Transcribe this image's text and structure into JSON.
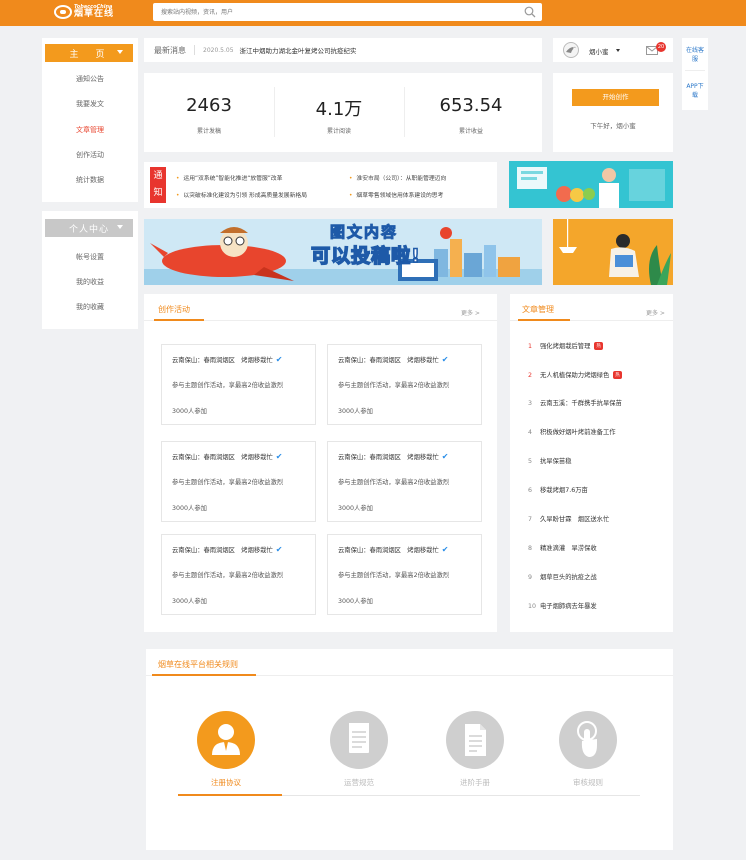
{
  "header": {
    "logo_en": "TobaccoChina",
    "logo_cn": "烟草在线",
    "search_placeholder": "搜索站内视频，资讯，用户"
  },
  "sidebar_main": {
    "title": "主　页",
    "items": [
      {
        "label": "通知公告",
        "active": false
      },
      {
        "label": "我要发文",
        "active": false
      },
      {
        "label": "文章管理",
        "active": true
      },
      {
        "label": "创作活动",
        "active": false
      },
      {
        "label": "统计数据",
        "active": false
      }
    ]
  },
  "sidebar_personal": {
    "title": "个人中心",
    "items": [
      {
        "label": "帐号设置"
      },
      {
        "label": "我的收益"
      },
      {
        "label": "我的收藏"
      }
    ]
  },
  "news": {
    "label": "最新消息",
    "date": "2020.5.05",
    "title": "浙江中烟助力湖北金叶复烤公司抗疫纪实"
  },
  "user": {
    "name": "烟小蜜",
    "unread": "20"
  },
  "side_tabs": [
    {
      "label": "在线客服"
    },
    {
      "label": "APP下载"
    }
  ],
  "stats": [
    {
      "value": "2463",
      "label": "累计发稿"
    },
    {
      "value": "4.1万",
      "label": "累计阅读"
    },
    {
      "value": "653.54",
      "label": "累计收益"
    }
  ],
  "start": {
    "button": "开始创作",
    "greeting": "下午好，烟小蜜"
  },
  "notice": {
    "tag": "通知",
    "items": [
      "运用“双系统”智能化推进“放管服”改革",
      "淮安市局（公司）：从职能管理迈向",
      "以突破标准化建设为引领 形成高质量发展新格局",
      "烟草零售领域信用体系建设的思考"
    ]
  },
  "banner": {
    "line1": "图文内容",
    "line2": "可以投稿啦!"
  },
  "creation": {
    "title": "创作活动",
    "more": "更多 >",
    "cards": [
      {
        "title": "云南保山：春雨润烟区　烤烟移栽忙",
        "desc": "参与主题创作活动，享最高2倍收益激烈",
        "count": "3000人参加"
      },
      {
        "title": "云南保山：春雨润烟区　烤烟移栽忙",
        "desc": "参与主题创作活动，享最高2倍收益激烈",
        "count": "3000人参加"
      },
      {
        "title": "云南保山：春雨润烟区　烤烟移栽忙",
        "desc": "参与主题创作活动，享最高2倍收益激烈",
        "count": "3000人参加"
      },
      {
        "title": "云南保山：春雨润烟区　烤烟移栽忙",
        "desc": "参与主题创作活动，享最高2倍收益激烈",
        "count": "3000人参加"
      },
      {
        "title": "云南保山：春雨润烟区　烤烟移栽忙",
        "desc": "参与主题创作活动，享最高2倍收益激烈",
        "count": "3000人参加"
      },
      {
        "title": "云南保山：春雨润烟区　烤烟移栽忙",
        "desc": "参与主题创作活动，享最高2倍收益激烈",
        "count": "3000人参加"
      }
    ]
  },
  "articles": {
    "title": "文章管理",
    "more": "更多 >",
    "hot_label": "热",
    "items": [
      {
        "rank": "1",
        "title": "强化烤烟栽后管理",
        "hot": true
      },
      {
        "rank": "2",
        "title": "无人机植保助力烤烟绿色",
        "hot": true
      },
      {
        "rank": "3",
        "title": "云南玉溪：千群携手抗旱保苗",
        "hot": false
      },
      {
        "rank": "4",
        "title": "积极做好烟叶烤前准备工作",
        "hot": false
      },
      {
        "rank": "5",
        "title": "抗旱保苗稳",
        "hot": false
      },
      {
        "rank": "6",
        "title": "移栽烤烟7.6万亩",
        "hot": false
      },
      {
        "rank": "7",
        "title": "久旱盼甘霖　烟区送水忙",
        "hot": false
      },
      {
        "rank": "8",
        "title": "精准滴灌　旱涝保收",
        "hot": false
      },
      {
        "rank": "9",
        "title": "烟草巨头的抗疫之战",
        "hot": false
      },
      {
        "rank": "10",
        "title": "电子烟肺病去年暴发",
        "hot": false
      }
    ]
  },
  "rules": {
    "title": "烟草在线平台相关规则",
    "tabs": [
      {
        "label": "注册协议",
        "icon": "person-icon",
        "active": true
      },
      {
        "label": "运营规范",
        "icon": "notepad-icon",
        "active": false
      },
      {
        "label": "进阶手册",
        "icon": "document-icon",
        "active": false
      },
      {
        "label": "审核规则",
        "icon": "touch-icon",
        "active": false
      }
    ]
  },
  "colors": {
    "brand": "#f08a1c",
    "accent_red": "#e8352e",
    "link_blue": "#2a77c9",
    "inactive_gray": "#cccccc"
  }
}
